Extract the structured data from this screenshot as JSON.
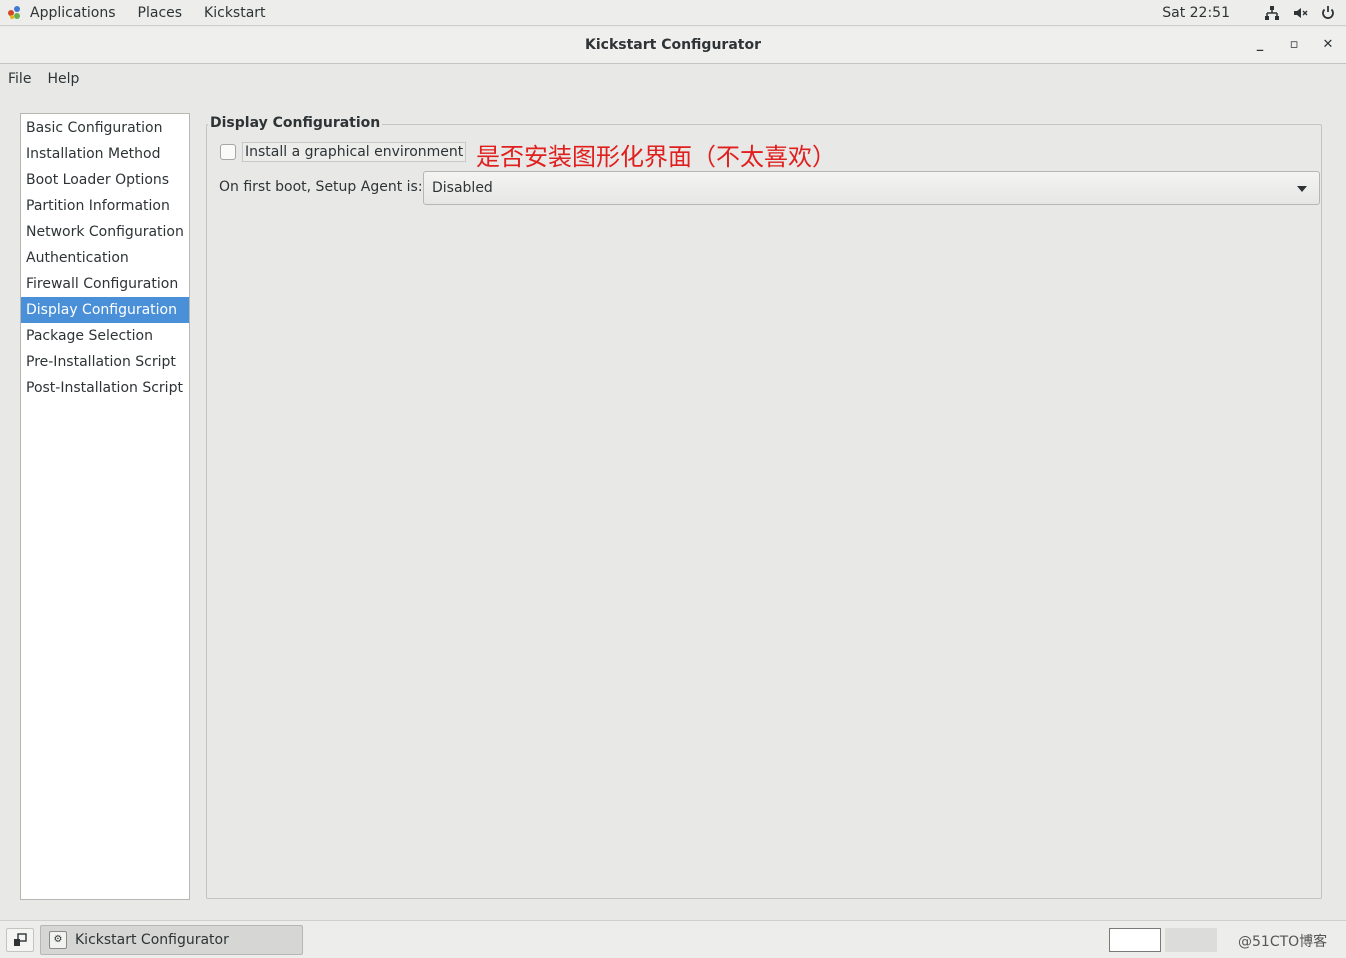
{
  "top_panel": {
    "applications": "Applications",
    "places": "Places",
    "kickstart": "Kickstart",
    "clock": "Sat 22:51"
  },
  "window": {
    "title": "Kickstart Configurator",
    "minimize": "_",
    "maximize": "▫",
    "close": "✕"
  },
  "menubar": {
    "file": "File",
    "help": "Help"
  },
  "sidebar": {
    "items": [
      {
        "label": "Basic Configuration"
      },
      {
        "label": "Installation Method"
      },
      {
        "label": "Boot Loader Options"
      },
      {
        "label": "Partition Information"
      },
      {
        "label": "Network Configuration"
      },
      {
        "label": "Authentication"
      },
      {
        "label": "Firewall Configuration"
      },
      {
        "label": "Display Configuration"
      },
      {
        "label": "Package Selection"
      },
      {
        "label": "Pre-Installation Script"
      },
      {
        "label": "Post-Installation Script"
      }
    ],
    "selected_index": 7
  },
  "main": {
    "frame_title": "Display Configuration",
    "graphical_checkbox_label": "Install a graphical environment",
    "graphical_checked": false,
    "annotation": "是否安装图形化界面（不太喜欢）",
    "agent_label": "On first boot, Setup Agent is:",
    "agent_value": "Disabled"
  },
  "taskbar": {
    "task_label": "Kickstart Configurator",
    "watermark": "@51CTO博客"
  },
  "colors": {
    "selection": "#4a90d9",
    "annotation": "#e0201f"
  }
}
